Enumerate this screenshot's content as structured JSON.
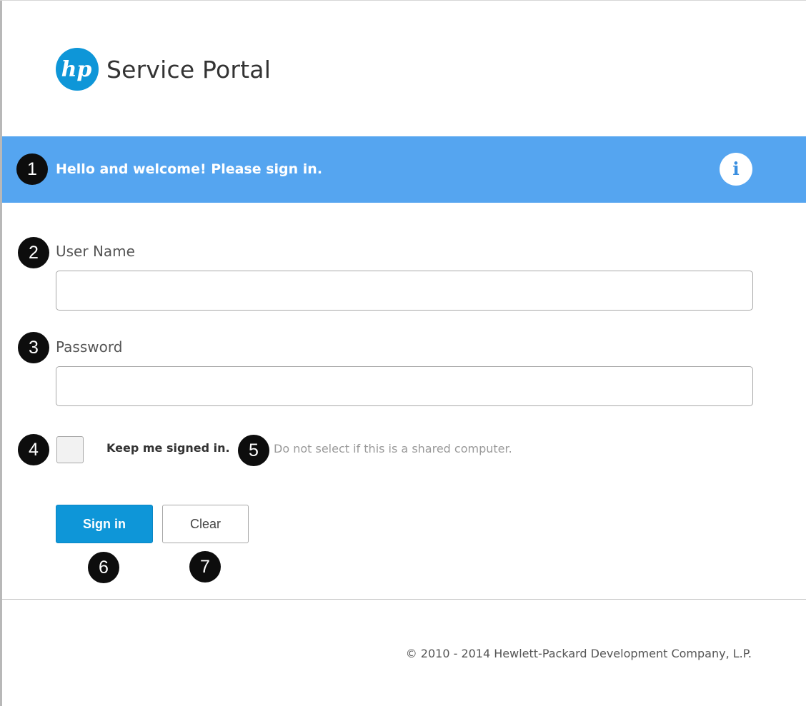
{
  "app": {
    "title": "Service Portal",
    "logo_text": "hp"
  },
  "banner": {
    "welcome_text": "Hello and welcome! Please sign in.",
    "info_glyph": "i",
    "icon": "info-icon"
  },
  "form": {
    "username_label": "User Name",
    "username_value": "",
    "password_label": "Password",
    "password_value": "",
    "keep_signed_in_label": "Keep me signed in.",
    "keep_signed_in_checked": false,
    "shared_computer_hint": "Do not select if this is a shared computer.",
    "sign_in_label": "Sign in",
    "clear_label": "Clear"
  },
  "markers": [
    "1",
    "2",
    "3",
    "4",
    "5",
    "6",
    "7"
  ],
  "footer": {
    "copyright": "© 2010 - 2014 Hewlett-Packard Development Company, L.P."
  },
  "colors": {
    "banner": "#55a5f0",
    "primary_button": "#0e96d8",
    "logo": "#0e96d8",
    "marker": "#0d0d0d"
  }
}
